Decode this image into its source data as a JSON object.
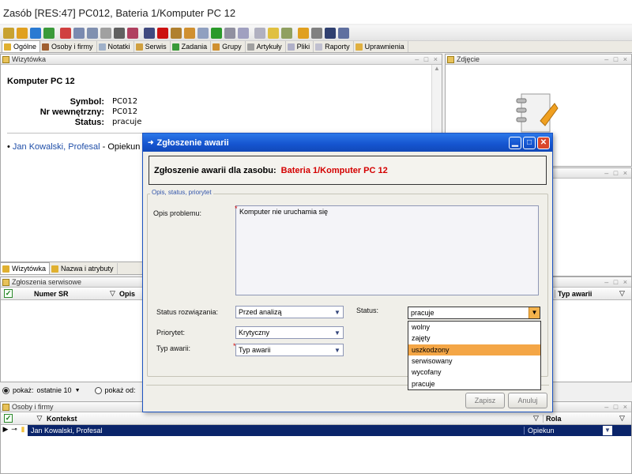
{
  "window": {
    "title": "Zasób [RES:47] PC012, Bateria 1/Komputer PC 12"
  },
  "toolbar": {
    "icons": [
      {
        "name": "new-icon",
        "color": "#c8a230"
      },
      {
        "name": "edit-icon",
        "color": "#e0a020"
      },
      {
        "name": "refresh-icon",
        "color": "#2a7ad2"
      },
      {
        "name": "tree-icon",
        "color": "#3a9a3a"
      },
      {
        "name": "pin-icon",
        "color": "#d04040"
      },
      {
        "name": "document-icon",
        "color": "#7a8ab0"
      },
      {
        "name": "copy-icon",
        "color": "#8090b0"
      },
      {
        "name": "folder-icon",
        "color": "#a0a0a0"
      },
      {
        "name": "save-icon",
        "color": "#606060"
      },
      {
        "name": "print-icon",
        "color": "#b04060"
      },
      {
        "name": "properties-icon",
        "color": "#404a80"
      },
      {
        "name": "delete-icon",
        "color": "#cc1111"
      },
      {
        "name": "users-icon",
        "color": "#b08030"
      },
      {
        "name": "tools-icon",
        "color": "#d09030"
      },
      {
        "name": "clone-icon",
        "color": "#90a0c0"
      },
      {
        "name": "go-icon",
        "color": "#2a9a2a"
      },
      {
        "name": "mail-icon",
        "color": "#9090a0"
      },
      {
        "name": "attach-icon",
        "color": "#a0a0c0"
      },
      {
        "name": "calendar-icon",
        "color": "#b0b0c0"
      },
      {
        "name": "notes-icon",
        "color": "#e0c040"
      },
      {
        "name": "export-icon",
        "color": "#90a060"
      },
      {
        "name": "puzzle-icon",
        "color": "#e0a020"
      },
      {
        "name": "home-icon",
        "color": "#808080"
      },
      {
        "name": "book-icon",
        "color": "#304070"
      },
      {
        "name": "image-icon",
        "color": "#6070a0"
      }
    ]
  },
  "tabs": [
    {
      "label": "Ogólne",
      "active": true
    },
    {
      "label": "Osoby i firmy"
    },
    {
      "label": "Notatki"
    },
    {
      "label": "Serwis"
    },
    {
      "label": "Zadania"
    },
    {
      "label": "Grupy"
    },
    {
      "label": "Artykuły"
    },
    {
      "label": "Pliki"
    },
    {
      "label": "Raporty"
    },
    {
      "label": "Uprawnienia"
    }
  ],
  "card": {
    "panel_title": "Wizytówka",
    "title": "Komputer PC 12",
    "fields": [
      {
        "label": "Symbol:",
        "value": "PC012"
      },
      {
        "label": "Nr wewnętrzny:",
        "value": "PC012"
      },
      {
        "label": "Status:",
        "value": "pracuje"
      }
    ],
    "person_link": "Jan Kowalski, Profesal",
    "person_suffix": " - Opiekun"
  },
  "photo": {
    "panel_title": "Zdjęcie"
  },
  "bottom_tabs": [
    "Wizytówka",
    "Nazwa i atrybuty"
  ],
  "service": {
    "panel_title": "Zgłoszenia serwisowe",
    "columns": [
      "Numer SR",
      "Opis",
      "Typ awarii"
    ],
    "filter_label": "pokaż:",
    "filter_value": "ostatnie 10",
    "filter_label2": "pokaż od:"
  },
  "people": {
    "panel_title": "Osoby i firmy",
    "columns": [
      "Kontekst",
      "Rola"
    ],
    "rows": [
      {
        "context": "Jan Kowalski, Profesal",
        "role": "Opiekun"
      }
    ]
  },
  "dialog": {
    "title": "Zgłoszenie awarii",
    "header_label": "Zgłoszenie awarii dla zasobu:",
    "header_resource": "Bateria 1/Komputer PC 12",
    "group_legend": "Opis, status, priorytet",
    "problem_label": "Opis problemu:",
    "problem_value": "Komputer nie uruchamia się",
    "resolution_label": "Status rozwiązania:",
    "resolution_value": "Przed analizą",
    "priority_label": "Priorytet:",
    "priority_value": "Krytyczny",
    "type_label": "Typ awarii:",
    "type_value": "Typ awarii",
    "status_label": "Status:",
    "status_value": "pracuje",
    "status_options": [
      "wolny",
      "zajęty",
      "uszkodzony",
      "serwisowany",
      "wycofany",
      "pracuje"
    ],
    "status_highlighted": "uszkodzony",
    "save_label": "Zapisz",
    "cancel_label": "Anuluj"
  },
  "colors": {
    "accent_blue": "#1554cf",
    "highlight": "#f4a646",
    "required": "#d40000",
    "selection": "#0a246a"
  }
}
